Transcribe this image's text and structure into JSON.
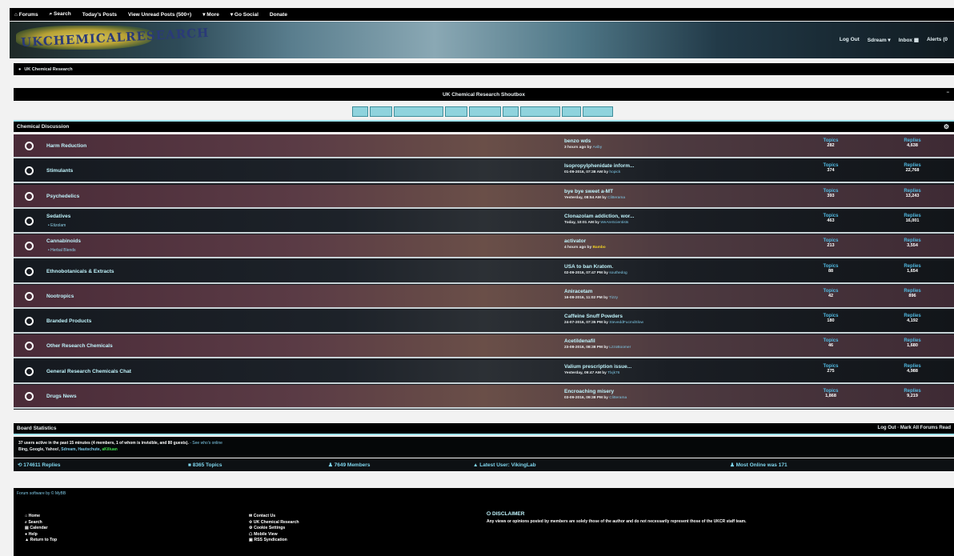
{
  "topnav": [
    {
      "icon": "home-icon",
      "label": "⌂ Forums"
    },
    {
      "icon": "search-icon",
      "label": "⌕ Search"
    },
    {
      "label": "Today's Posts"
    },
    {
      "label": "View Unread Posts (500+)"
    },
    {
      "label": "▾ More"
    },
    {
      "label": "▾ Go Social"
    },
    {
      "label": "Donate"
    }
  ],
  "header": {
    "logo_text": "UKCHEMICALRESEARCH",
    "links": [
      "Log Out",
      "Sdream ▾",
      "Inbox ▦",
      "Alerts (0"
    ]
  },
  "breadcrumb": {
    "icon": "globe-icon",
    "label": "UK Chemical Research"
  },
  "shoutbox": {
    "title": "UK Chemical Research Shoutbox",
    "toggle": "−",
    "button_widths": [
      20,
      28,
      62,
      28,
      40,
      20,
      50,
      24,
      38
    ]
  },
  "category": {
    "title": "Chemical Discussion"
  },
  "stat_labels": {
    "topics": "Topics",
    "replies": "Replies"
  },
  "forums": [
    {
      "name": "Harm Reduction",
      "sub": "",
      "lp_title": "benzo wds",
      "lp_when": "3 hours ago by",
      "lp_user": "Aviby",
      "topics": "282",
      "replies": "4,638"
    },
    {
      "name": "Stimulants",
      "sub": "",
      "lp_title": "Isopropylphenidate inform...",
      "lp_when": "01-09-2016, 07:38 AM by",
      "lp_user": "hopick",
      "topics": "374",
      "replies": "22,768"
    },
    {
      "name": "Psychedelics",
      "sub": "",
      "lp_title": "bye bye sweet a-MT",
      "lp_when": "Yesterday, 08:54 AM by",
      "lp_user": "Clitterama",
      "topics": "393",
      "replies": "13,243"
    },
    {
      "name": "Sedatives",
      "sub": "• Etizolam",
      "lp_title": "Clonazolam addiction, wor...",
      "lp_when": "Today, 10:01 AM by",
      "lp_user": "WeAreScientists",
      "topics": "463",
      "replies": "16,001"
    },
    {
      "name": "Cannabinoids",
      "sub": "• Herbal Blends",
      "lp_title": "activator",
      "lp_when": "4 hours ago by",
      "lp_user": "Bambo",
      "lp_user_gold": true,
      "topics": "213",
      "replies": "3,554"
    },
    {
      "name": "Ethnobotanicals & Extracts",
      "sub": "",
      "lp_title": "USA to ban Kratom.",
      "lp_when": "02-09-2016, 07:47 PM by",
      "lp_user": "southedog",
      "topics": "88",
      "replies": "1,654"
    },
    {
      "name": "Nootropics",
      "sub": "",
      "lp_title": "Aniracetam",
      "lp_when": "16-08-2016, 11:02 PM by",
      "lp_user": "Tizzy",
      "topics": "42",
      "replies": "896"
    },
    {
      "name": "Branded Products",
      "sub": "",
      "lp_title": "Caffeine Snuff Powders",
      "lp_when": "24-07-2016, 07:35 PM by",
      "lp_user": "SteveddFucmdSlow",
      "topics": "180",
      "replies": "4,192"
    },
    {
      "name": "Other Research Chemicals",
      "sub": "",
      "lp_title": "Acetildenafil",
      "lp_when": "23-08-2016, 08:38 PM by",
      "lp_user": "LzzoBoomer",
      "topics": "46",
      "replies": "1,680"
    },
    {
      "name": "General Research Chemicals Chat",
      "sub": "",
      "lp_title": "Valium prescription issue...",
      "lp_when": "Yesterday, 09:47 AM by",
      "lp_user": "Tlxjk76",
      "topics": "275",
      "replies": "4,988"
    },
    {
      "name": "Drugs News",
      "sub": "",
      "lp_title": "Encroaching misery",
      "lp_when": "03-09-2016, 09:38 PM by",
      "lp_user": "Clitterama",
      "topics": "1,868",
      "replies": "9,219"
    }
  ],
  "board_stats": {
    "title": "Board Statistics",
    "right_links": "Log Out · Mark All Forums Read",
    "online_text": "37 users active in the past 15 minutes (4 members, 1 of whom is invisible, and 80 guests).",
    "see_who": "- See who's online",
    "bots_prefix": "Bing, Google, Yahoo!,",
    "bots_blue": "Sdream, Hautschute,",
    "bots_green": "aKiliuan",
    "bar": [
      {
        "icon": "replies-icon",
        "text": "⟲ 174611 Replies"
      },
      {
        "icon": "topics-icon",
        "text": "■ 8365 Topics"
      },
      {
        "icon": "members-icon",
        "text": "♟ 7649 Members"
      },
      {
        "icon": "user-icon",
        "text": "▲ Latest User: VikingLab"
      },
      {
        "icon": "group-icon",
        "text": "♟ Most Online was 171"
      }
    ]
  },
  "footer": {
    "powered": "Forum software by © MyBB",
    "col1": [
      "⌂ Home",
      "⌕ Search",
      "▤ Calendar",
      "● Help",
      "▲ Return to Top"
    ],
    "col2": [
      "✉ Contact Us",
      "✣ UK Chemical Research",
      "⚙ Cookie Settings",
      "☖ Mobile View",
      "▣ RSS Syndication"
    ],
    "disclaimer_title": "⭘ DISCLAIMER",
    "disclaimer_body": "Any views or opinions posted by members are solely those of the author and do not necessarily represent those of the UKCR staff team."
  }
}
